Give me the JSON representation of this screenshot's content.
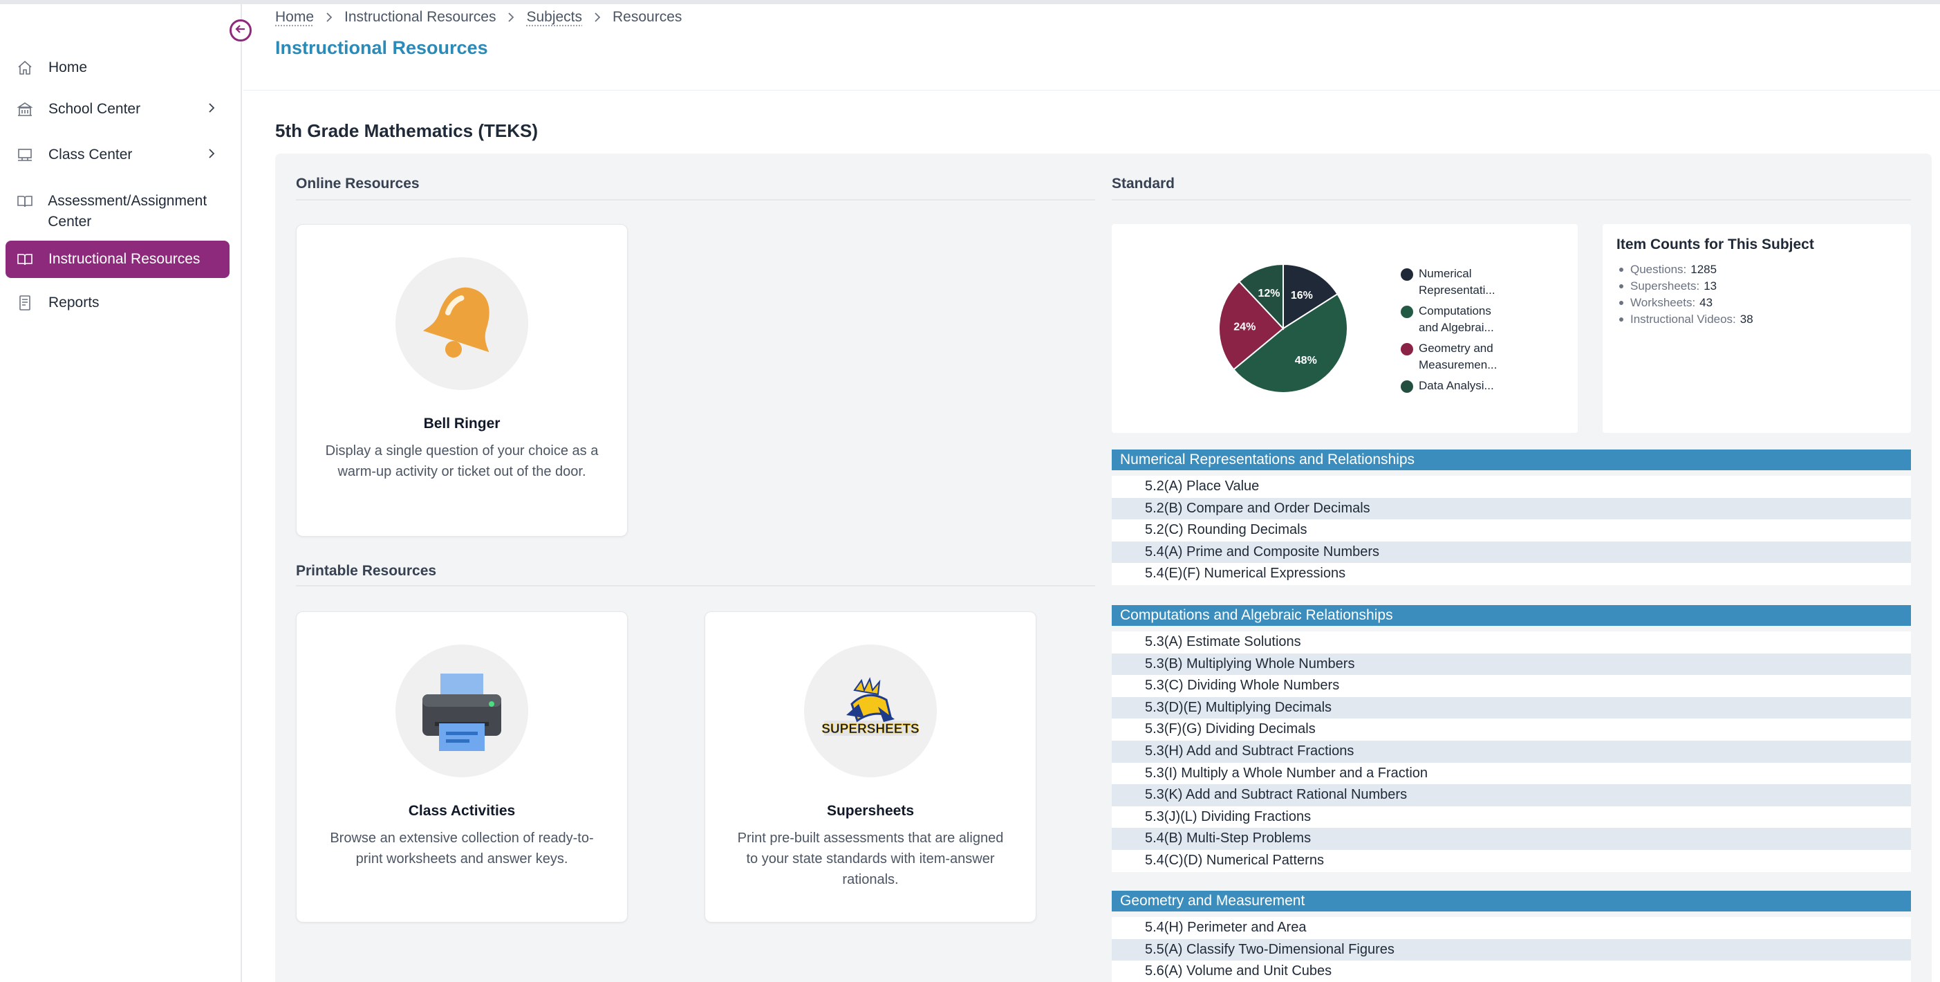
{
  "sidebar": {
    "items": [
      {
        "label": "Home",
        "icon": "home-icon",
        "has_children": false,
        "active": false
      },
      {
        "label": "School Center",
        "icon": "school-icon",
        "has_children": true,
        "active": false
      },
      {
        "label": "Class Center",
        "icon": "classroom-icon",
        "has_children": true,
        "active": false
      },
      {
        "label": "Assessment/Assignment Center",
        "icon": "book-open-icon",
        "has_children": false,
        "active": false
      },
      {
        "label": "Instructional Resources",
        "icon": "book-open-icon",
        "has_children": false,
        "active": true
      },
      {
        "label": "Reports",
        "icon": "report-icon",
        "has_children": false,
        "active": false
      }
    ],
    "collapse_icon": "arrow-left-circle-icon",
    "accent_color": "#8e2a7c"
  },
  "breadcrumb": {
    "items": [
      "Home",
      "Instructional Resources",
      "Subjects",
      "Resources"
    ]
  },
  "header": {
    "title": "Instructional Resources",
    "title_color": "#2a8ab8"
  },
  "subject": {
    "title": "5th Grade Mathematics (TEKS)"
  },
  "online_resources": {
    "heading": "Online Resources",
    "cards": [
      {
        "title": "Bell Ringer",
        "description": "Display a single question of your choice as a warm-up activity or ticket out of the door.",
        "icon": "bell-icon"
      }
    ]
  },
  "printable_resources": {
    "heading": "Printable Resources",
    "cards": [
      {
        "title": "Class Activities",
        "description": "Browse an extensive collection of ready-to-print worksheets and answer keys.",
        "icon": "printer-icon"
      },
      {
        "title": "Supersheets",
        "description": "Print pre-built assessments that are aligned to your state standards with item-answer rationals.",
        "icon": "supersheets-logo-icon",
        "logo_text": "SUPERSHEETS"
      }
    ]
  },
  "standard": {
    "heading": "Standard",
    "chart_data": {
      "type": "pie",
      "slices": [
        {
          "label": "Numerical Representati...",
          "value": 16,
          "display": "16%",
          "color": "#1f2937"
        },
        {
          "label": "Computations and Algebrai...",
          "value": 48,
          "display": "48%",
          "color": "#235a45"
        },
        {
          "label": "Geometry and Measuremen...",
          "value": 24,
          "display": "24%",
          "color": "#8b2346"
        },
        {
          "label": "Data Analysi...",
          "value": 12,
          "display": "12%",
          "color": "#234f40"
        }
      ],
      "legend_position": "right"
    },
    "counts": {
      "title": "Item Counts for This Subject",
      "items": [
        {
          "label": "Questions:",
          "value": "1285"
        },
        {
          "label": "Supersheets:",
          "value": "13"
        },
        {
          "label": "Worksheets:",
          "value": "43"
        },
        {
          "label": "Instructional Videos:",
          "value": "38"
        }
      ]
    },
    "header_color": "#3a8dbc",
    "groups": [
      {
        "title": "Numerical Representations and Relationships",
        "items": [
          "5.2(A) Place Value",
          "5.2(B) Compare and Order Decimals",
          "5.2(C) Rounding Decimals",
          "5.4(A) Prime and Composite Numbers",
          "5.4(E)(F) Numerical Expressions"
        ]
      },
      {
        "title": "Computations and Algebraic Relationships",
        "items": [
          "5.3(A) Estimate Solutions",
          "5.3(B) Multiplying Whole Numbers",
          "5.3(C) Dividing Whole Numbers",
          "5.3(D)(E) Multiplying Decimals",
          "5.3(F)(G) Dividing Decimals",
          "5.3(H) Add and Subtract Fractions",
          "5.3(I) Multiply a Whole Number and a Fraction",
          "5.3(K) Add and Subtract Rational Numbers",
          "5.3(J)(L) Dividing Fractions",
          "5.4(B) Multi-Step Problems",
          "5.4(C)(D) Numerical Patterns"
        ]
      },
      {
        "title": "Geometry and Measurement",
        "items": [
          "5.4(H) Perimeter and Area",
          "5.5(A) Classify Two-Dimensional Figures",
          "5.6(A) Volume and Unit Cubes"
        ]
      }
    ]
  }
}
